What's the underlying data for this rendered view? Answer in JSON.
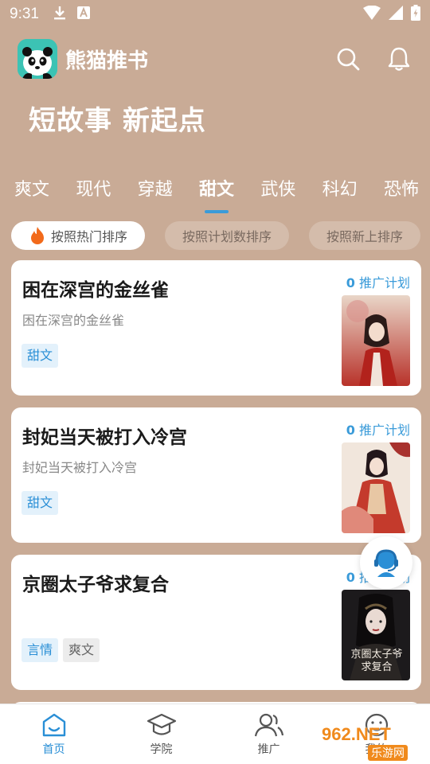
{
  "status_bar": {
    "time": "9:31"
  },
  "header": {
    "app_title": "熊猫推书"
  },
  "slogan": "短故事 新起点",
  "category_tabs": [
    {
      "label": "爽文"
    },
    {
      "label": "现代"
    },
    {
      "label": "穿越"
    },
    {
      "label": "甜文",
      "active": true
    },
    {
      "label": "武侠"
    },
    {
      "label": "科幻"
    },
    {
      "label": "恐怖"
    }
  ],
  "sort_options": [
    {
      "label": "按照热门排序",
      "active": true
    },
    {
      "label": "按照计划数排序"
    },
    {
      "label": "按照新上排序"
    }
  ],
  "books": [
    {
      "title": "困在深宫的金丝雀",
      "subtitle": "困在深宫的金丝雀",
      "promo_count": "0",
      "promo_label": "推广计划",
      "tags": [
        "甜文"
      ]
    },
    {
      "title": "封妃当天被打入冷宫",
      "subtitle": "封妃当天被打入冷宫",
      "promo_count": "0",
      "promo_label": "推广计划",
      "tags": [
        "甜文"
      ]
    },
    {
      "title": "京圈太子爷求复合",
      "subtitle": "",
      "promo_count": "0",
      "promo_label": "推广计划",
      "tags": [
        "言情",
        "爽文"
      ],
      "cover_text": "京圈太子爷求复合"
    }
  ],
  "bottom_nav": [
    {
      "label": "首页",
      "active": true
    },
    {
      "label": "学院"
    },
    {
      "label": "推广"
    },
    {
      "label": "我的"
    }
  ],
  "watermark": {
    "text1": "962.NET",
    "text2": "乐游网"
  },
  "colors": {
    "background": "#c9ab96",
    "accent": "#3a9bd9",
    "tag_blue_bg": "#e3f1fb"
  }
}
